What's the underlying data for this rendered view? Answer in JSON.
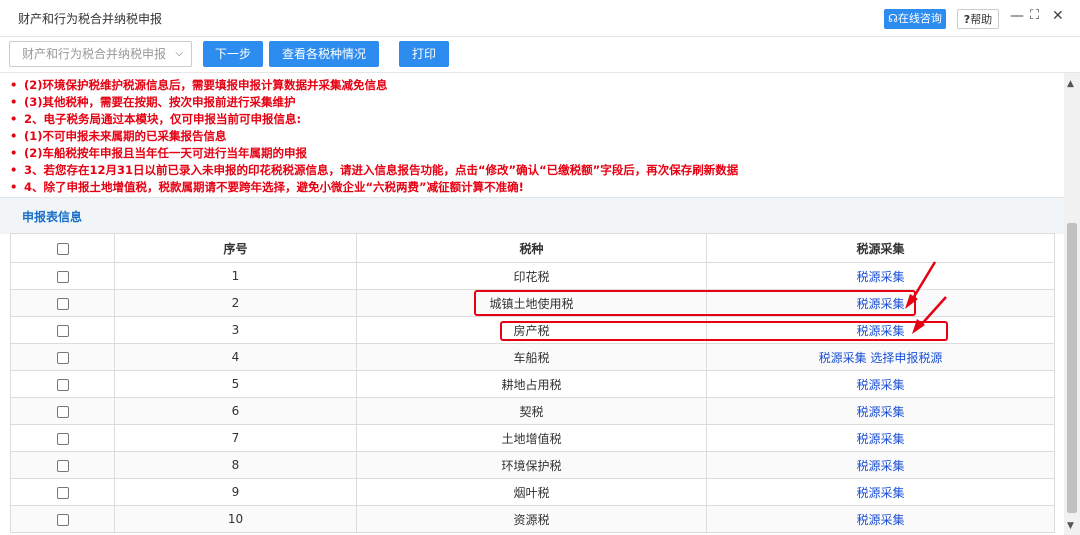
{
  "window": {
    "title": "财产和行为税合并纳税申报",
    "online_btn": "在线咨询",
    "help_btn": "帮助",
    "minimize": "—",
    "maximize": "⛶",
    "close": "✕"
  },
  "toolbar": {
    "select_value": "财产和行为税合并纳税申报",
    "next_label": "下一步",
    "view_label": "查看各税种情况",
    "print_label": "打印"
  },
  "notices": [
    "(2)环境保护税维护税源信息后，需要填报申报计算数据并采集减免信息",
    "(3)其他税种，需要在按期、按次申报前进行采集维护",
    "2、电子税务局通过本模块，仅可申报当前可申报信息:",
    "(1)不可申报未来属期的已采集报告信息",
    "(2)车船税按年申报且当年任一天可进行当年属期的申报",
    "3、若您存在12月31日以前已录入未申报的印花税税源信息，请进入信息报告功能，点击“修改”确认“已缴税额”字段后，再次保存刷新数据",
    "4、除了申报土地增值税，税款属期请不要跨年选择，避免小微企业“六税两费”减征额计算不准确!"
  ],
  "section_title": "申报表信息",
  "table": {
    "headers": [
      "序号",
      "税种",
      "税源采集"
    ],
    "rows": [
      {
        "no": "1",
        "tax": "印花税",
        "action": "税源采集",
        "extra": ""
      },
      {
        "no": "2",
        "tax": "城镇土地使用税",
        "action": "税源采集",
        "extra": ""
      },
      {
        "no": "3",
        "tax": "房产税",
        "action": "税源采集",
        "extra": ""
      },
      {
        "no": "4",
        "tax": "车船税",
        "action": "税源采集",
        "extra": "选择申报税源"
      },
      {
        "no": "5",
        "tax": "耕地占用税",
        "action": "税源采集",
        "extra": ""
      },
      {
        "no": "6",
        "tax": "契税",
        "action": "税源采集",
        "extra": ""
      },
      {
        "no": "7",
        "tax": "土地增值税",
        "action": "税源采集",
        "extra": ""
      },
      {
        "no": "8",
        "tax": "环境保护税",
        "action": "税源采集",
        "extra": ""
      },
      {
        "no": "9",
        "tax": "烟叶税",
        "action": "税源采集",
        "extra": ""
      },
      {
        "no": "10",
        "tax": "资源税",
        "action": "税源采集",
        "extra": ""
      }
    ]
  },
  "colors": {
    "accent": "#2d8cf0",
    "notice": "#e60012",
    "link": "#1a4fd6"
  }
}
